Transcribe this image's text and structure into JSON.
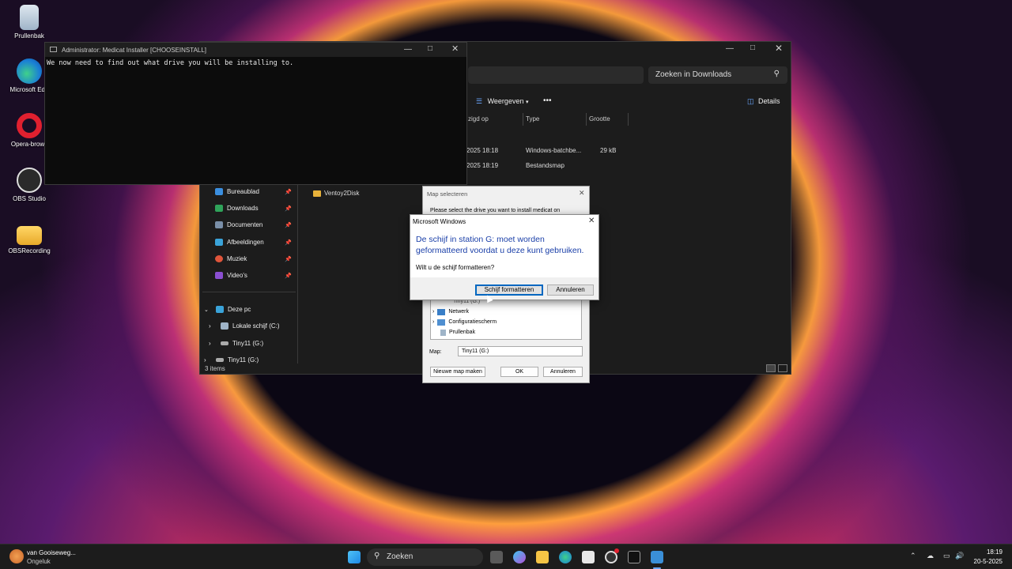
{
  "desktop": {
    "icons": [
      {
        "label": "Prullenbak",
        "icon": "recycle-bin-icon"
      },
      {
        "label": "Microsoft Edg",
        "icon": "edge-icon"
      },
      {
        "label": "Opera-brows",
        "icon": "opera-icon"
      },
      {
        "label": "OBS Studio",
        "icon": "obs-icon"
      },
      {
        "label": "OBSRecording",
        "icon": "folder-icon"
      }
    ]
  },
  "terminal": {
    "title": "Administrator:  Medicat Installer [CHOOSEINSTALL]",
    "text": "We now need to find out what drive you will be installing to."
  },
  "explorer": {
    "search_placeholder": "Zoeken in Downloads",
    "toolbar": {
      "view_label": "Weergeven",
      "details_label": "Details",
      "more": "•••"
    },
    "columns": [
      "zigd op",
      "Type",
      "Grootte"
    ],
    "rows": [
      {
        "date": "2025 18:18",
        "type": "Windows-batchbe...",
        "size": "29 kB"
      },
      {
        "date": "2025 18:19",
        "type": "Bestandsmap",
        "size": ""
      }
    ],
    "folder_item": "Ventoy2Disk",
    "nav": [
      {
        "label": "Bureaublad",
        "color": "#3b8fe0"
      },
      {
        "label": "Downloads",
        "color": "#2fa35a"
      },
      {
        "label": "Documenten",
        "color": "#7a8fa8"
      },
      {
        "label": "Afbeeldingen",
        "color": "#3aa3d9"
      },
      {
        "label": "Muziek",
        "color": "#e0553b"
      },
      {
        "label": "Video's",
        "color": "#8a4fd1"
      }
    ],
    "tree": [
      {
        "label": "Deze pc"
      },
      {
        "label": "Lokale schijf (C:)"
      },
      {
        "label": "Tiny11 (G:)"
      },
      {
        "label": "Tiny11 (G:)"
      }
    ],
    "status": "3 items"
  },
  "folder_dialog": {
    "title": "Map selecteren",
    "prompt": "Please select the drive you want to install medicat on",
    "tree": [
      "Tiny11 (G:)",
      "Netwerk",
      "Configuratiescherm",
      "Prullenbak"
    ],
    "folder_label": "Map:",
    "folder_value": "Tiny11 (G:)",
    "new_folder": "Nieuwe map maken",
    "ok": "OK",
    "cancel": "Annuleren"
  },
  "msgbox": {
    "title": "Microsoft Windows",
    "heading": "De schijf in station G: moet worden geformatteerd voordat u deze kunt gebruiken.",
    "question": "Wilt u de schijf formatteren?",
    "format_button": "Schijf formatteren",
    "cancel_button": "Annuleren"
  },
  "taskbar": {
    "weather_title": "van Gooiseweg...",
    "weather_sub": "Ongeluk",
    "search_placeholder": "Zoeken",
    "time": "18:19",
    "date": "20-5-2025"
  }
}
